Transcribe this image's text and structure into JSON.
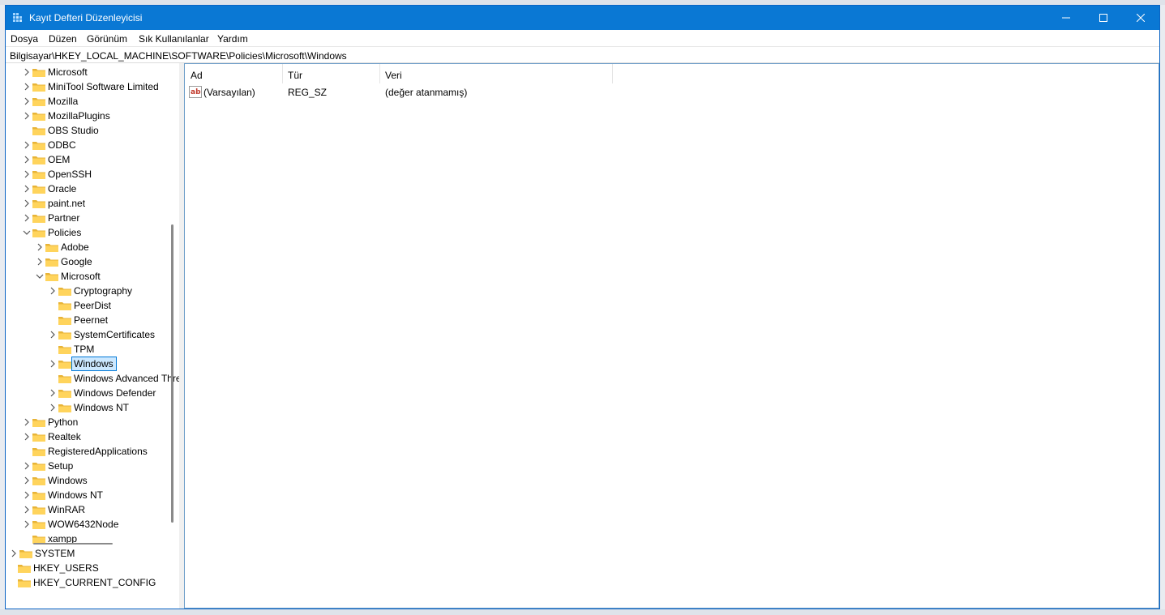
{
  "window": {
    "title": "Kayıt Defteri Düzenleyicisi",
    "accent": "#0a78d4"
  },
  "menu": [
    "Dosya",
    "Düzen",
    "Görünüm",
    "Sık Kullanılanlar",
    "Yardım"
  ],
  "address": "Bilgisayar\\HKEY_LOCAL_MACHINE\\SOFTWARE\\Policies\\Microsoft\\Windows",
  "tree": [
    {
      "label": "Microsoft",
      "level": 1,
      "expander": "collapsed"
    },
    {
      "label": "MiniTool Software Limited",
      "level": 1,
      "expander": "collapsed"
    },
    {
      "label": "Mozilla",
      "level": 1,
      "expander": "collapsed"
    },
    {
      "label": "MozillaPlugins",
      "level": 1,
      "expander": "collapsed"
    },
    {
      "label": "OBS Studio",
      "level": 1,
      "expander": "none"
    },
    {
      "label": "ODBC",
      "level": 1,
      "expander": "collapsed"
    },
    {
      "label": "OEM",
      "level": 1,
      "expander": "collapsed"
    },
    {
      "label": "OpenSSH",
      "level": 1,
      "expander": "collapsed"
    },
    {
      "label": "Oracle",
      "level": 1,
      "expander": "collapsed"
    },
    {
      "label": "paint.net",
      "level": 1,
      "expander": "collapsed"
    },
    {
      "label": "Partner",
      "level": 1,
      "expander": "collapsed"
    },
    {
      "label": "Policies",
      "level": 1,
      "expander": "expanded"
    },
    {
      "label": "Adobe",
      "level": 2,
      "expander": "collapsed"
    },
    {
      "label": "Google",
      "level": 2,
      "expander": "collapsed"
    },
    {
      "label": "Microsoft",
      "level": 2,
      "expander": "expanded"
    },
    {
      "label": "Cryptography",
      "level": 3,
      "expander": "collapsed"
    },
    {
      "label": "PeerDist",
      "level": 3,
      "expander": "none"
    },
    {
      "label": "Peernet",
      "level": 3,
      "expander": "none"
    },
    {
      "label": "SystemCertificates",
      "level": 3,
      "expander": "collapsed"
    },
    {
      "label": "TPM",
      "level": 3,
      "expander": "none"
    },
    {
      "label": "Windows",
      "level": 3,
      "expander": "collapsed",
      "selected": true
    },
    {
      "label": "Windows Advanced Threat Protection",
      "level": 3,
      "expander": "none"
    },
    {
      "label": "Windows Defender",
      "level": 3,
      "expander": "collapsed"
    },
    {
      "label": "Windows NT",
      "level": 3,
      "expander": "collapsed"
    },
    {
      "label": "Python",
      "level": 1,
      "expander": "collapsed"
    },
    {
      "label": "Realtek",
      "level": 1,
      "expander": "collapsed"
    },
    {
      "label": "RegisteredApplications",
      "level": 1,
      "expander": "none"
    },
    {
      "label": "Setup",
      "level": 1,
      "expander": "collapsed"
    },
    {
      "label": "Windows",
      "level": 1,
      "expander": "collapsed"
    },
    {
      "label": "Windows NT",
      "level": 1,
      "expander": "collapsed"
    },
    {
      "label": "WinRAR",
      "level": 1,
      "expander": "collapsed"
    },
    {
      "label": "WOW6432Node",
      "level": 1,
      "expander": "collapsed"
    },
    {
      "label": "xampp",
      "level": 1,
      "expander": "none"
    },
    {
      "label": "SYSTEM",
      "level": 0,
      "expander": "collapsed"
    },
    {
      "label": "HKEY_USERS",
      "level": -1,
      "expander": "collapsed"
    },
    {
      "label": "HKEY_CURRENT_CONFIG",
      "level": -1,
      "expander": "collapsed"
    }
  ],
  "list": {
    "columns": [
      "Ad",
      "Tür",
      "Veri"
    ],
    "rows": [
      {
        "name": "(Varsayılan)",
        "type": "REG_SZ",
        "data": "(değer atanmamış)",
        "icon": "string-value-icon"
      }
    ]
  }
}
